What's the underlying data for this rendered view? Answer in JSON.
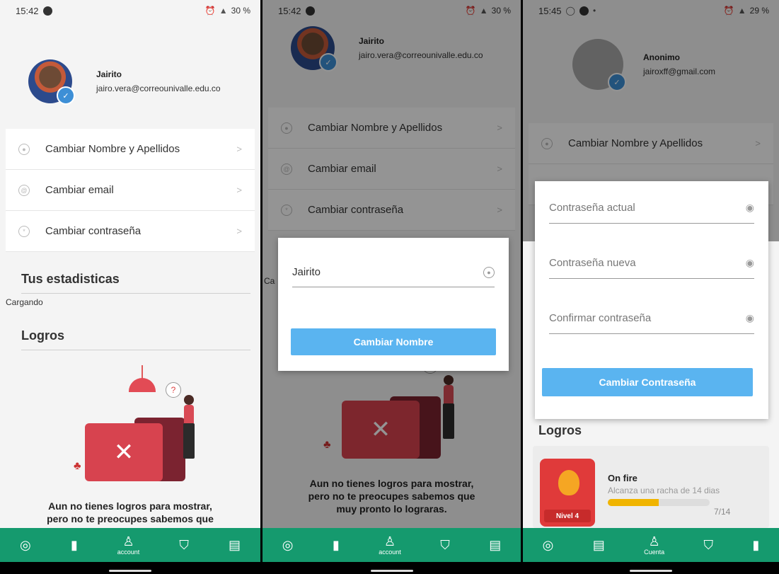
{
  "screen1": {
    "status": {
      "time": "15:42",
      "battery": "30 %"
    },
    "profile": {
      "name": "Jairito",
      "email": "jairo.vera@correounivalle.edu.co"
    },
    "menu": [
      {
        "label": "Cambiar Nombre y Apellidos"
      },
      {
        "label": "Cambiar email"
      },
      {
        "label": "Cambiar contraseña"
      }
    ],
    "stats_title": "Tus estadisticas",
    "loading": "Cargando",
    "achievements_title": "Logros",
    "empty_line1": "Aun no tienes logros para mostrar,",
    "empty_line2": "pero no te preocupes sabemos que",
    "nav": {
      "account_label": "account"
    }
  },
  "screen2": {
    "status": {
      "time": "15:42",
      "battery": "30 %"
    },
    "profile": {
      "name": "Jairito",
      "email": "jairo.vera@correounivalle.edu.co"
    },
    "menu": [
      {
        "label": "Cambiar Nombre y Apellidos"
      },
      {
        "label": "Cambiar email"
      },
      {
        "label": "Cambiar contraseña"
      }
    ],
    "peek": "Ca",
    "dialog": {
      "name_value": "Jairito",
      "button": "Cambiar Nombre"
    },
    "empty_line1": "Aun no tienes logros para mostrar,",
    "empty_line2": "pero no te preocupes sabemos que",
    "empty_line3": "muy pronto lo lograras.",
    "nav": {
      "account_label": "account"
    }
  },
  "screen3": {
    "status": {
      "time": "15:45",
      "battery": "29 %"
    },
    "profile": {
      "name": "Anonimo",
      "email": "jairoxff@gmail.com"
    },
    "menu": [
      {
        "label": "Cambiar Nombre y Apellidos"
      }
    ],
    "dialog": {
      "current_placeholder": "Contraseña actual",
      "new_placeholder": "Contraseña nueva",
      "confirm_placeholder": "Confirmar contraseña",
      "button": "Cambiar Contraseña"
    },
    "achievements_title": "Logros",
    "achievement": {
      "title": "On fire",
      "description": "Alcanza una racha de 14 dias",
      "level": "Nivel 4",
      "progress": "7/14",
      "fraction": 0.5
    },
    "nav": {
      "account_label": "Cuenta"
    }
  },
  "colors": {
    "nav": "#159a6e",
    "button": "#5ab4f0",
    "folder": "#d7434f"
  },
  "icons": {
    "nav": [
      "compass-icon",
      "book-icon",
      "account-icon",
      "shield-check-icon",
      "store-icon"
    ]
  }
}
